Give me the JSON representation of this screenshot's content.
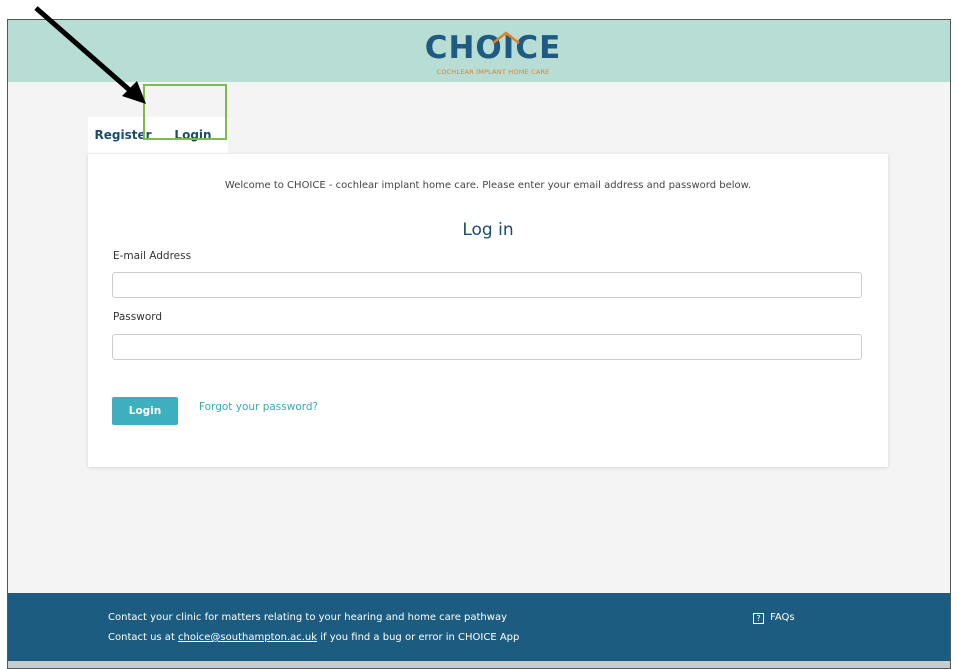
{
  "header": {
    "logo_text": "CHOICE",
    "logo_subtitle": "COCHLEAR IMPLANT HOME CARE",
    "colors": {
      "bar": "#b7ddd4",
      "logo_blue": "#1f5a80",
      "logo_orange": "#e0822a"
    }
  },
  "tabs": [
    {
      "label": "Register",
      "active": false
    },
    {
      "label": "Login",
      "active": true
    }
  ],
  "card": {
    "welcome": "Welcome to CHOICE - cochlear implant home care. Please enter your email address and password below.",
    "heading": "Log in",
    "email_label": "E-mail Address",
    "email_value": "",
    "password_label": "Password",
    "password_value": "",
    "login_button": "Login",
    "forgot_link": "Forgot your password?"
  },
  "footer": {
    "line1": "Contact your clinic for matters relating to your hearing and home care pathway",
    "line2_prefix": "Contact us at ",
    "line2_email": "choice@southampton.ac.uk",
    "line2_suffix": " if you find a bug or error in CHOICE App",
    "faqs_label": "FAQs",
    "faqs_icon": "?",
    "color": "#1b5c80"
  },
  "annotation": {
    "arrow_icon": "black-arrow-icon",
    "highlight_color": "#7dbb4c"
  }
}
